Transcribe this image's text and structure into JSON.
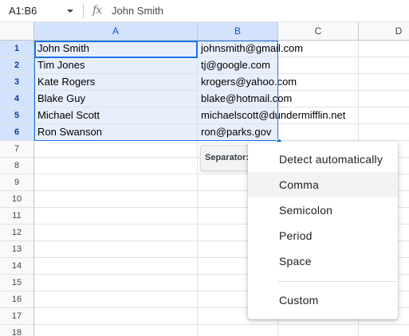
{
  "formula_bar": {
    "name_box": "A1:B6",
    "fx_icon": "fx-icon",
    "formula": "John Smith"
  },
  "columns": [
    "A",
    "B",
    "C",
    "D"
  ],
  "rows": [
    "1",
    "2",
    "3",
    "4",
    "5",
    "6",
    "7",
    "8",
    "9",
    "10",
    "11",
    "12",
    "13",
    "14",
    "15",
    "16",
    "17",
    "18"
  ],
  "cells": [
    {
      "a": "John Smith",
      "b": "johnsmith@gmail.com"
    },
    {
      "a": "Tim Jones",
      "b": "tj@google.com"
    },
    {
      "a": "Kate Rogers",
      "b": "krogers@yahoo.com"
    },
    {
      "a": "Blake Guy",
      "b": "blake@hotmail.com"
    },
    {
      "a": "Michael Scott",
      "b": "michaelscott@dundermifflin.net"
    },
    {
      "a": "Ron Swanson",
      "b": "ron@parks.gov"
    }
  ],
  "separator": {
    "label": "Separator:"
  },
  "dropdown": {
    "options": [
      "Detect automatically",
      "Comma",
      "Semicolon",
      "Period",
      "Space",
      "Custom"
    ],
    "hovered": "Comma"
  },
  "colors": {
    "selection_border": "#1a73e8",
    "selection_fill": "#e8effc",
    "header_selected": "#d3e3fd"
  }
}
